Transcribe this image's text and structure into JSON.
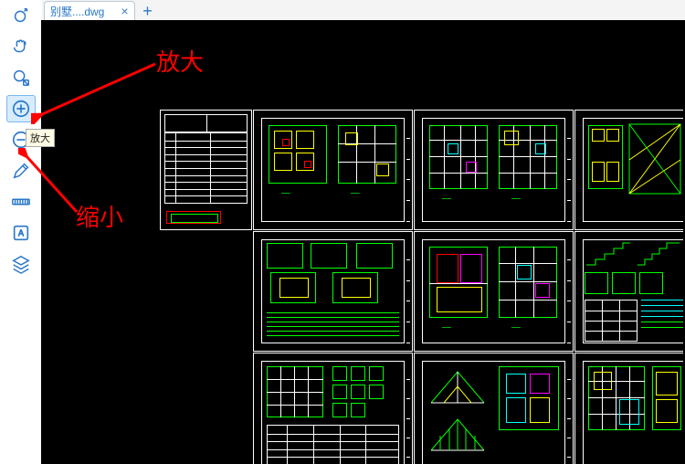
{
  "tab": {
    "filename": "别墅....dwg"
  },
  "tooltip": {
    "zoom_in": "放大"
  },
  "annotations": {
    "zoom_in": "放大",
    "zoom_out": "缩小"
  },
  "tools": {
    "orbit": "orbit-tool",
    "pan": "pan-tool",
    "zoom_area": "zoom-area-tool",
    "zoom_in": "zoom-in-tool",
    "zoom_out": "zoom-out-tool",
    "pencil": "pencil-tool",
    "measure": "measure-tool",
    "text": "text-tool",
    "layers": "layers-tool"
  }
}
